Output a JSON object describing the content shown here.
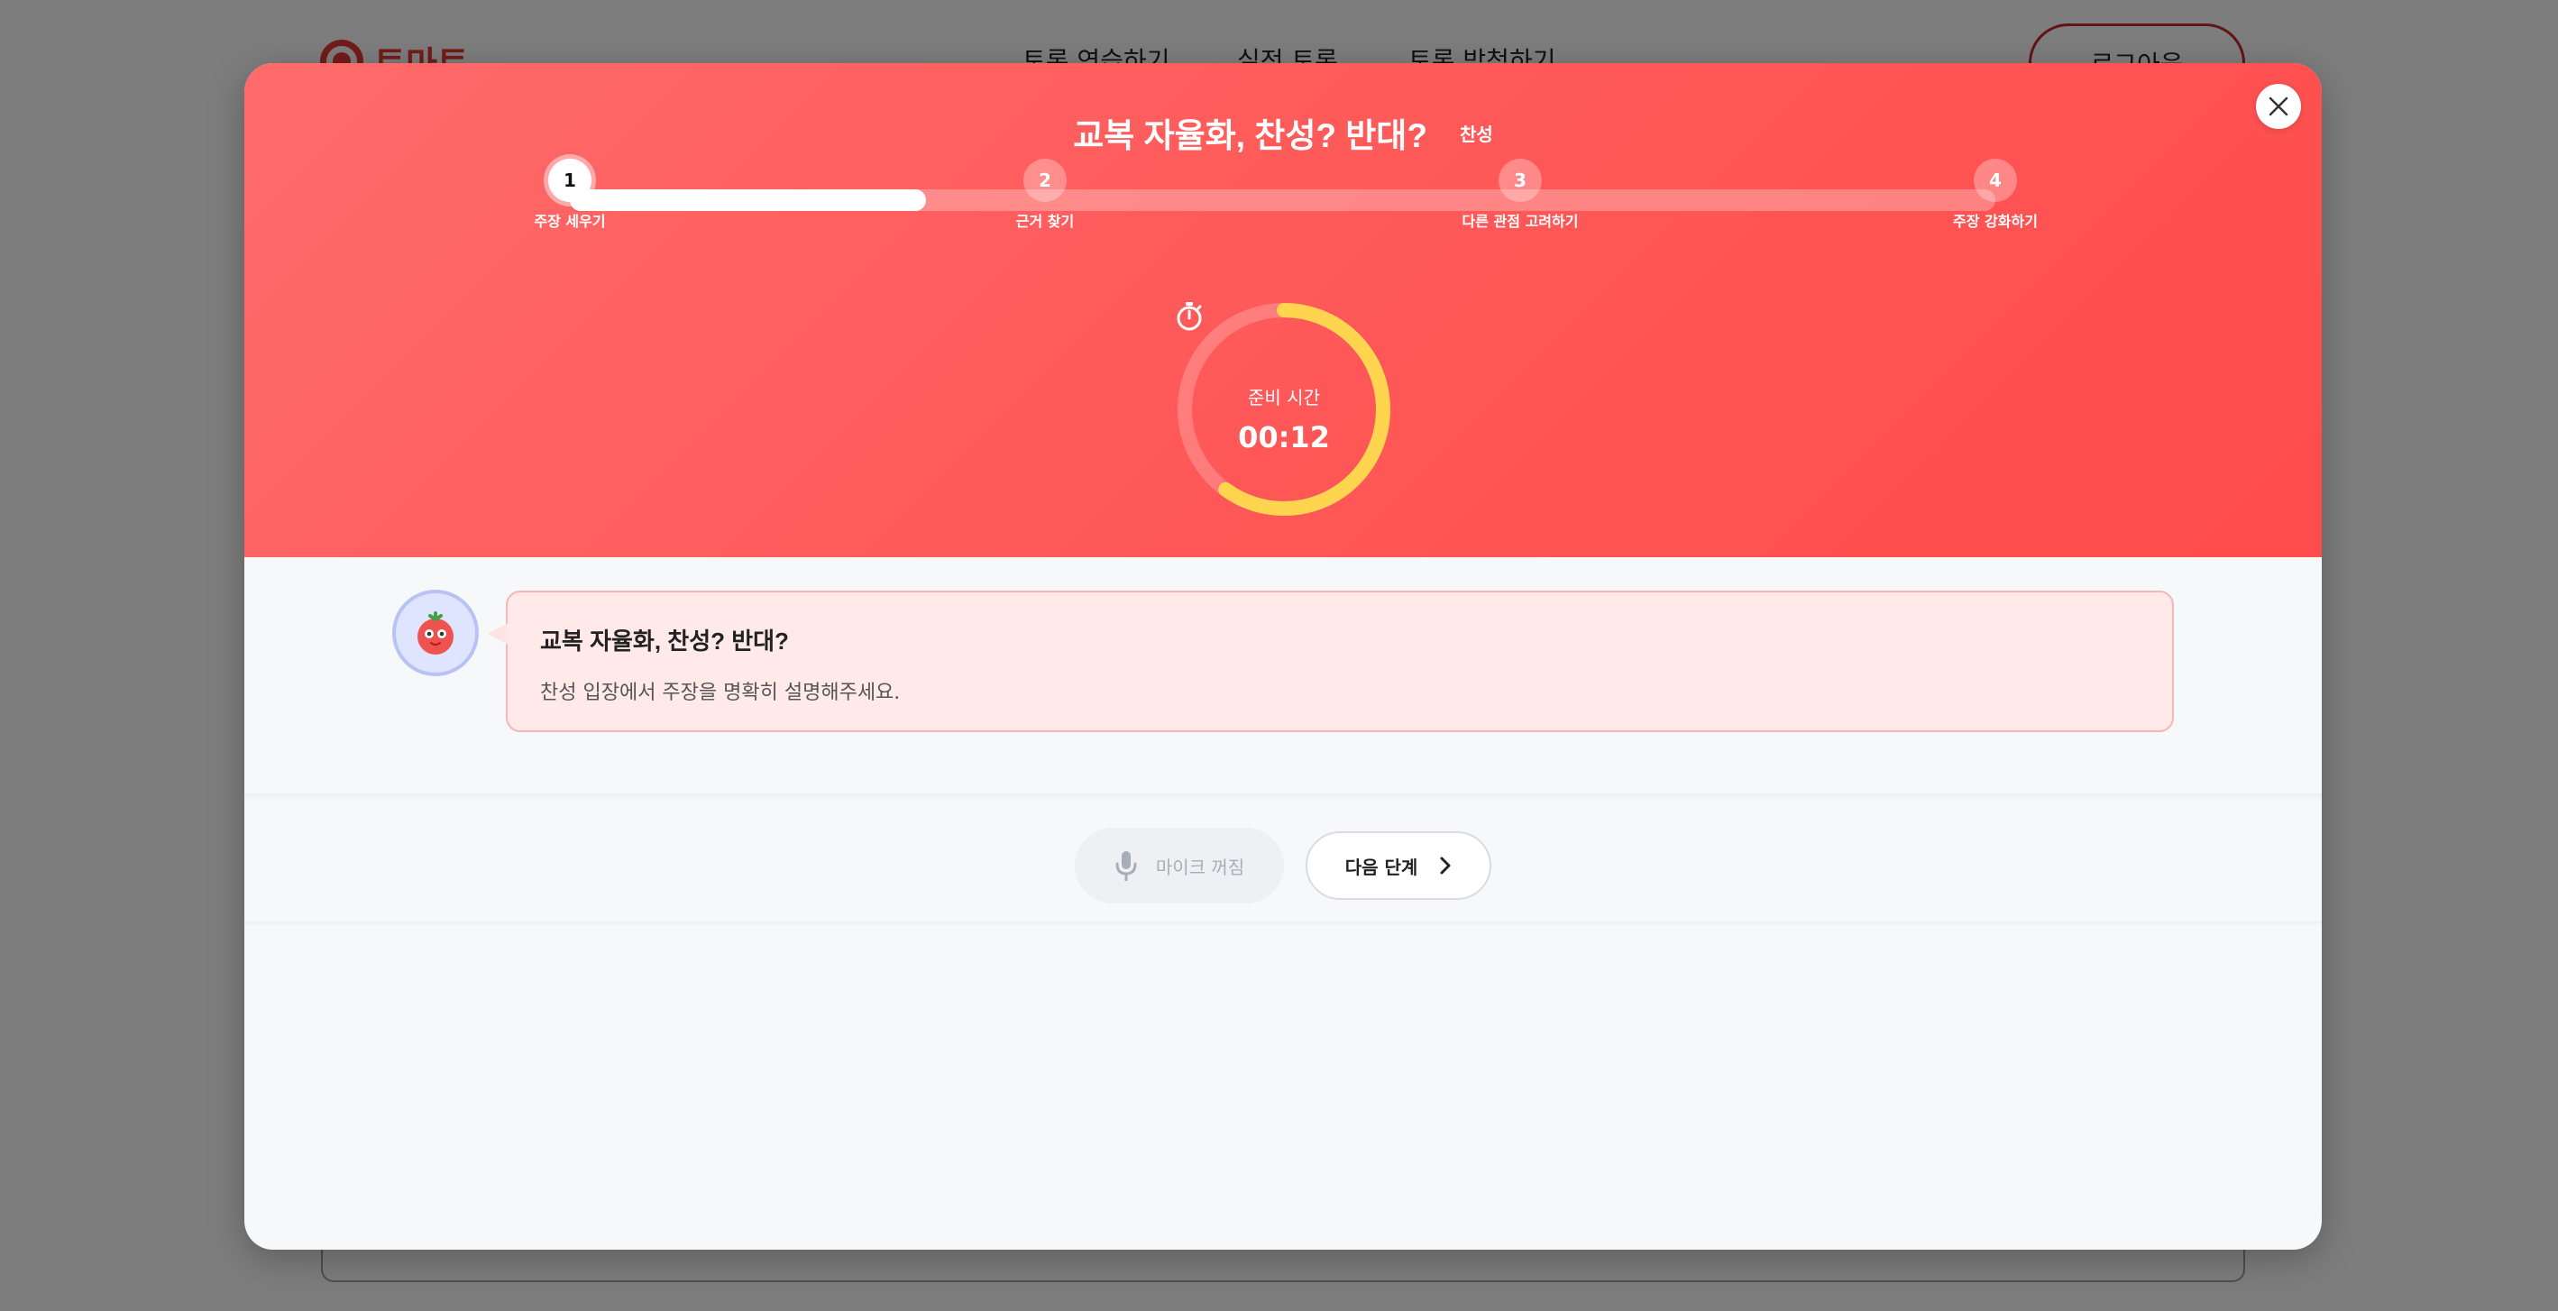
{
  "background": {
    "logo_text": "토마토",
    "nav": [
      "토론 연습하기",
      "실전 토론",
      "토론 방청하기"
    ],
    "logout_label": "로그아웃"
  },
  "modal": {
    "title": "교복 자율화, 찬성? 반대?",
    "stance": "찬성",
    "progress_fraction": 0.25,
    "steps": [
      {
        "number": "1",
        "label": "주장 세우기"
      },
      {
        "number": "2",
        "label": "근거 찾기"
      },
      {
        "number": "3",
        "label": "다른 관점 고려하기"
      },
      {
        "number": "4",
        "label": "주장 강화하기"
      }
    ],
    "active_step": 1,
    "timer": {
      "icon": "stopwatch-icon",
      "label": "준비 시간",
      "value": "00:12",
      "remaining_fraction": 0.6,
      "ring_color": "#ffd54f"
    },
    "message": {
      "title": "교복 자율화, 찬성? 반대?",
      "text": "찬성 입장에서 주장을 명확히 설명해주세요."
    },
    "controls": {
      "mic_label": "마이크 꺼짐",
      "next_label": "다음 단계"
    }
  },
  "colors": {
    "hero_gradient_start": "#ff6b6b",
    "hero_gradient_end": "#ff4c4c",
    "accent": "#e53935",
    "bubble_bg": "#ffe9e9"
  }
}
